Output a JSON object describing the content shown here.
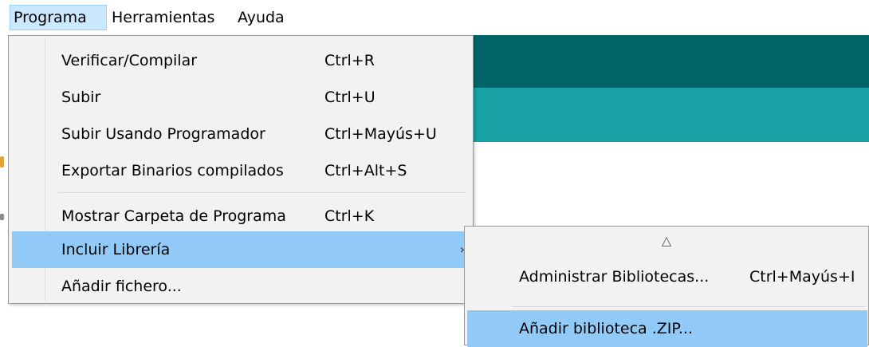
{
  "menubar": {
    "items": [
      {
        "label": "Programa"
      },
      {
        "label": "Herramientas"
      },
      {
        "label": "Ayuda"
      }
    ]
  },
  "dropdown": {
    "items": [
      {
        "label": "Verificar/Compilar",
        "shortcut": "Ctrl+R"
      },
      {
        "label": "Subir",
        "shortcut": "Ctrl+U"
      },
      {
        "label": "Subir Usando Programador",
        "shortcut": "Ctrl+Mayús+U"
      },
      {
        "label": "Exportar Binarios compilados",
        "shortcut": "Ctrl+Alt+S"
      },
      {
        "label": "Mostrar Carpeta de Programa",
        "shortcut": "Ctrl+K"
      },
      {
        "label": "Incluir Librería",
        "arrow": "›"
      },
      {
        "label": "Añadir fichero..."
      }
    ]
  },
  "submenu": {
    "scroll_up_glyph": "△",
    "items": [
      {
        "label": "Administrar Bibliotecas...",
        "shortcut": "Ctrl+Mayús+I"
      },
      {
        "label": "Añadir biblioteca .ZIP..."
      }
    ]
  },
  "colors": {
    "highlight": "#91c9f7",
    "menu_background": "#f2f2f2",
    "editor_header_dark": "#006468",
    "editor_header_light": "#17a1a5"
  }
}
